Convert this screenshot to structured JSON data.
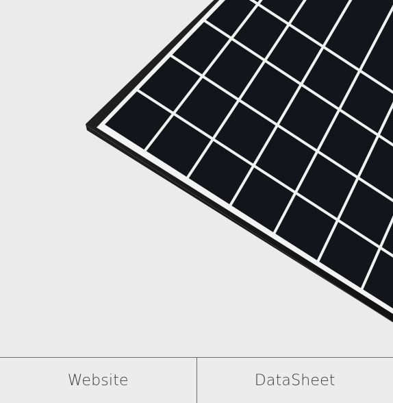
{
  "product_image": {
    "subject": "solar-panel-icon"
  },
  "links": {
    "website_label": "Website",
    "datasheet_label": "DataSheet"
  },
  "colors": {
    "background": "#ebebeb",
    "panel_frame": "#141414",
    "panel_cell": "#15161b",
    "panel_grid": "#f4f4f4",
    "divider": "#6c6c6c",
    "link_text": "#3a3a3a"
  }
}
